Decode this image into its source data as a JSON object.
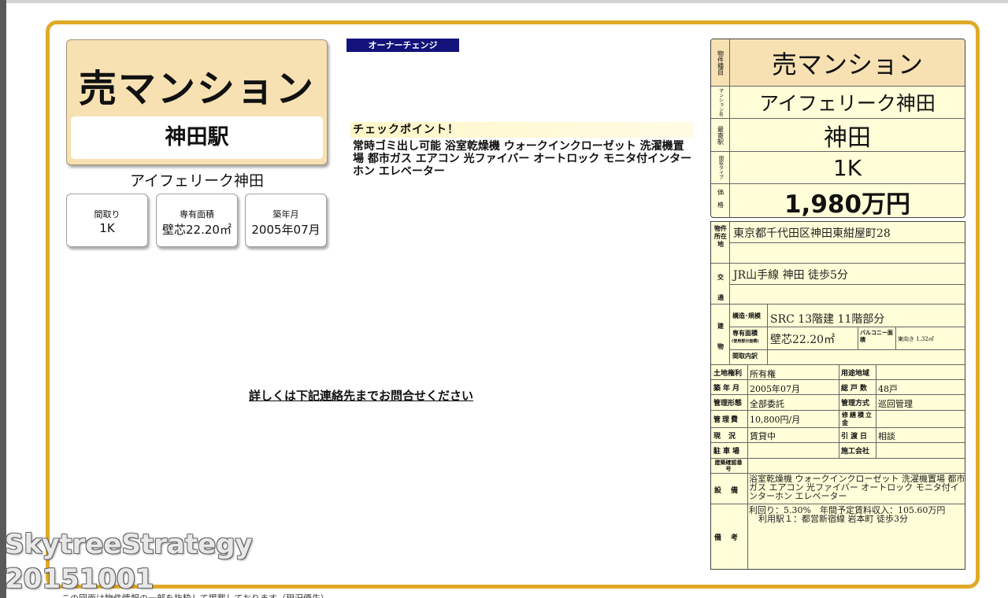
{
  "badge": "オーナーチェンジ",
  "hero": {
    "title": "売マンション",
    "station": "神田駅",
    "name": "アイフェリーク神田"
  },
  "cards": [
    {
      "label": "間取り",
      "value": "1K"
    },
    {
      "label": "専有面積",
      "value": "壁芯22.20㎡"
    },
    {
      "label": "築年月",
      "value": "2005年07月"
    }
  ],
  "checkpoint": {
    "heading": "チェックポイント！",
    "body": "常時ゴミ出し可能 浴室乾燥機 ウォークインクローゼット 洗濯機置場 都市ガス エアコン 光ファイバー オートロック モニタ付インターホン エレベーター"
  },
  "contact": "詳しくは下記連絡先までお問合せください",
  "summary": {
    "type_label": "物件種目",
    "type": "売マンション",
    "name_label": "マンション名",
    "name": "アイフェリーク神田",
    "station_label": "最寄駅",
    "station": "神田",
    "layout_label": "間取タイプ",
    "layout": "1K",
    "price_label": "価格",
    "price": "1,980万円"
  },
  "details": {
    "address_label": "物件所在地",
    "address": "東京都千代田区神田東紺屋町28",
    "transport_label": "交通",
    "transport": "JR山手線 神田 徒歩5分",
    "building_label": "建物",
    "structure_label": "構造･規模",
    "structure": "SRC 13階建 11階部分",
    "area_label": "専有面積",
    "area_note": "(使用部分面積)",
    "area": "壁芯22.20㎡",
    "balcony_label": "バルコニー面積",
    "balcony": "東向き 1.32㎡",
    "interior_label": "間取内訳",
    "interior": "",
    "rows": [
      {
        "l1": "土地権利",
        "v1": "所有権",
        "l2": "用途地域",
        "v2": ""
      },
      {
        "l1": "築年月",
        "v1": "2005年07月",
        "l2": "総戸数",
        "v2": "48戸"
      },
      {
        "l1": "管理形態",
        "v1": "全部委託",
        "l2": "管理方式",
        "v2": "巡回管理"
      },
      {
        "l1": "管理費",
        "v1": "10,800円/月",
        "l2": "修繕積立金",
        "v2": ""
      },
      {
        "l1": "現況",
        "v1": "賃貸中",
        "l2": "引渡日",
        "v2": "相談"
      },
      {
        "l1": "駐車場",
        "v1": "",
        "l2": "施工会社",
        "v2": ""
      }
    ],
    "confirm_label": "建築確認番号",
    "confirm": "",
    "equipment_label": "設備",
    "equipment": "浴室乾燥機 ウォークインクローゼット 洗濯機置場 都市ガス エアコン 光ファイバー オートロック モニタ付インターホン エレベーター",
    "remarks_label": "備考",
    "remarks_1": "利回り：5.30%　年間予定賃料収入：105.60万円",
    "remarks_2": "利用駅１：都営新宿線 岩本町 徒歩3分"
  },
  "watermark": {
    "line1": "SkytreeStrategy",
    "line2": "20151001"
  },
  "footer": "この図面は物件情報の一部を抜粋して掲載しております（現況優先）"
}
